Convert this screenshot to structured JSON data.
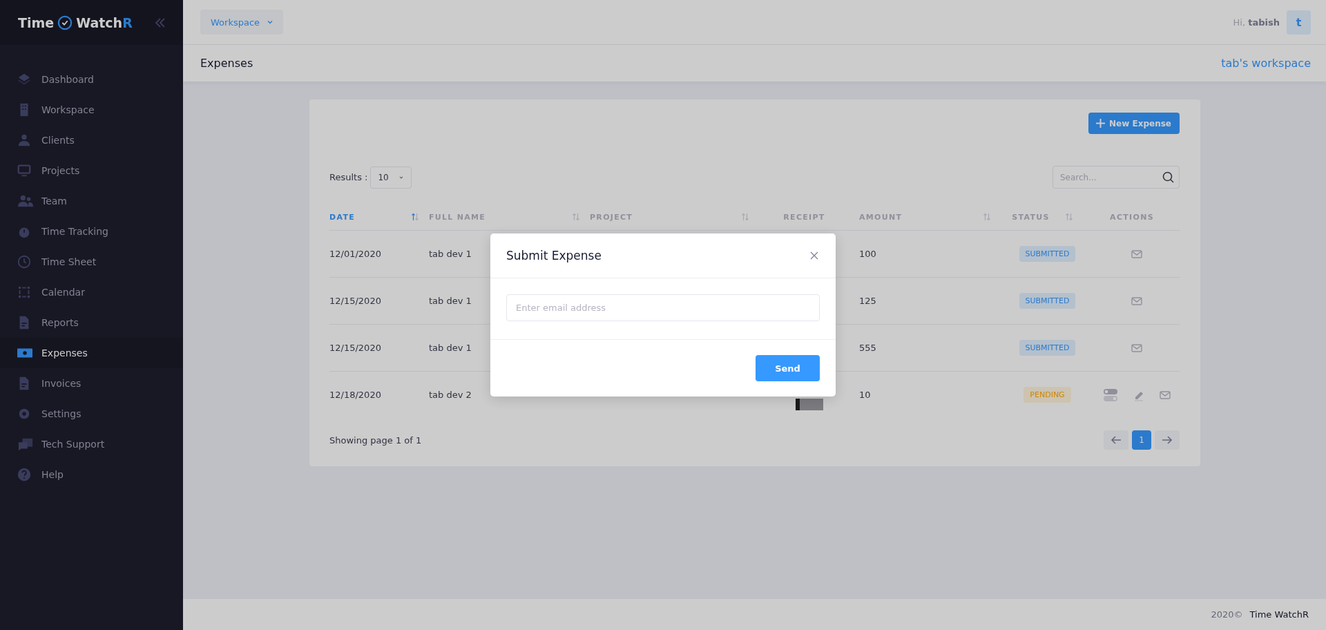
{
  "sidebar": {
    "logo": {
      "first": "Time",
      "second": "Watch",
      "accent": "R"
    },
    "items": [
      {
        "label": "Dashboard",
        "selected": false
      },
      {
        "label": "Workspace",
        "selected": false
      },
      {
        "label": "Clients",
        "selected": false
      },
      {
        "label": "Projects",
        "selected": false
      },
      {
        "label": "Team",
        "selected": false
      },
      {
        "label": "Time Tracking",
        "selected": false
      },
      {
        "label": "Time Sheet",
        "selected": false
      },
      {
        "label": "Calendar",
        "selected": false
      },
      {
        "label": "Reports",
        "selected": false
      },
      {
        "label": "Expenses",
        "selected": true
      },
      {
        "label": "Invoices",
        "selected": false
      },
      {
        "label": "Settings",
        "selected": false
      },
      {
        "label": "Tech Support",
        "selected": false
      },
      {
        "label": "Help",
        "selected": false
      }
    ]
  },
  "header": {
    "workspace_menu": "Workspace",
    "greeting": "Hi, **tabish**",
    "avatar": "t"
  },
  "subheader": {
    "title": "Expenses",
    "workspace": "tab's workspace"
  },
  "card": {
    "new_button": "New Expense",
    "results_label": "Results :",
    "results_value": "10",
    "search": {
      "placeholder": "Search..."
    }
  },
  "table": {
    "columns": [
      {
        "label": "DATE",
        "sortable": true,
        "sorted": true
      },
      {
        "label": "FULL NAME",
        "sortable": true,
        "sorted": false
      },
      {
        "label": "PROJECT",
        "sortable": true,
        "sorted": false
      },
      {
        "label": "RECEIPT",
        "sortable": false,
        "sorted": false
      },
      {
        "label": "AMOUNT",
        "sortable": true,
        "sorted": false
      },
      {
        "label": "STATUS",
        "sortable": true,
        "sorted": false
      },
      {
        "label": "ACTIONS",
        "sortable": false,
        "sorted": false
      }
    ],
    "rows": [
      {
        "date": "12/01/2020",
        "full_name": "tab dev 1",
        "amount": "100",
        "status": {
          "label": "SUBMITTED",
          "kind": "submitted"
        },
        "actions": [
          {
            "kind": "email"
          }
        ]
      },
      {
        "date": "12/15/2020",
        "full_name": "tab dev 1",
        "amount": "125",
        "status": {
          "label": "SUBMITTED",
          "kind": "submitted"
        },
        "actions": [
          {
            "kind": "email"
          }
        ]
      },
      {
        "date": "12/15/2020",
        "full_name": "tab dev 1",
        "amount": "555",
        "status": {
          "label": "SUBMITTED",
          "kind": "submitted"
        },
        "actions": [
          {
            "kind": "email"
          }
        ]
      },
      {
        "date": "12/18/2020",
        "full_name": "tab dev 2",
        "amount": "10",
        "receipt": true,
        "status": {
          "label": "PENDING",
          "kind": "pending"
        },
        "actions": [
          {
            "kind": "toggle"
          },
          {
            "kind": "edit"
          },
          {
            "kind": "email"
          }
        ]
      }
    ]
  },
  "pagination": {
    "summary": "Showing page 1 of 1",
    "pages": [
      {
        "label": "1",
        "selected": true
      }
    ]
  },
  "modal": {
    "title": "Submit Expense",
    "email": {
      "placeholder": "Enter email address"
    },
    "send_button": "Send"
  },
  "footer": {
    "year": "2020©",
    "brand": "Time WatchR"
  }
}
